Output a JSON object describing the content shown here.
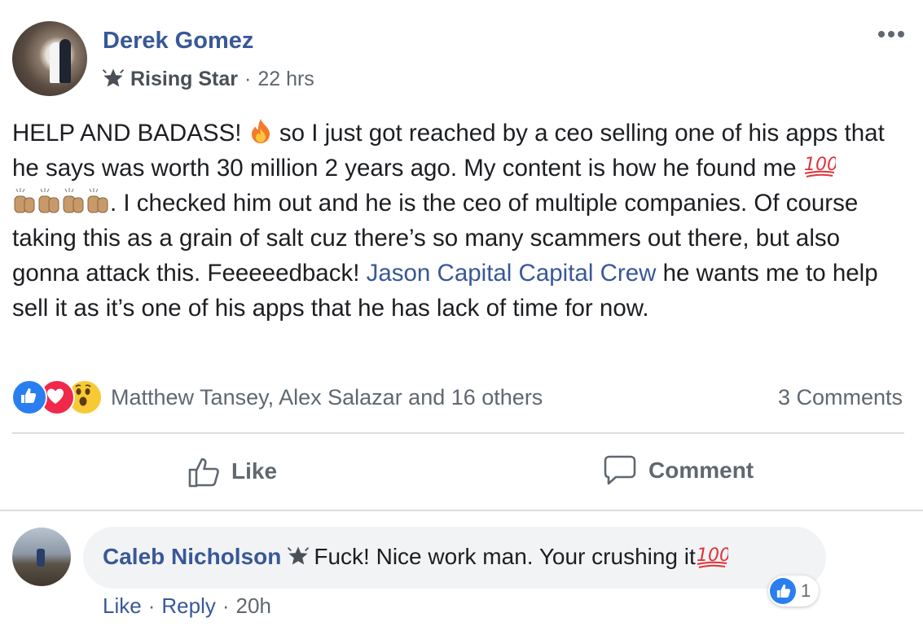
{
  "post": {
    "author": "Derek Gomez",
    "badge": "Rising Star",
    "time": "22 hrs",
    "text": {
      "part1": "HELP AND BADASS!",
      "part2": "so I just got reached by a ceo selling one of his apps that he says was worth 30 million 2 years ago. My content is how he found me",
      "part3": ". I checked him out and he is the ceo of multiple companies. Of course taking this as a grain of salt cuz there’s so many scammers out there, but also gonna attack this. Feeeeedback!",
      "mention": "Jason Capital Capital Crew",
      "part4": "he wants me to help sell it as it’s one of his apps that he has lack of time for now."
    },
    "reactions_text": "Matthew Tansey, Alex Salazar and 16 others",
    "comments_count": "3 Comments",
    "actions": {
      "like": "Like",
      "comment": "Comment"
    }
  },
  "comment": {
    "author": "Caleb Nicholson",
    "text": "Fuck! Nice work man. Your crushing it",
    "like_count": "1",
    "actions": {
      "like": "Like",
      "reply": "Reply",
      "time": "20h"
    }
  },
  "icons": [
    "rising-star-icon",
    "fire-emoji",
    "hundred-emoji",
    "clapping-hands-emoji",
    "like-reaction-icon",
    "love-reaction-icon",
    "wow-reaction-icon",
    "thumbs-up-icon",
    "comment-bubble-icon",
    "more-options-icon"
  ],
  "colors": {
    "link": "#385898",
    "secondary": "#606770",
    "like_blue": "#2a7ef0",
    "love_red": "#f0284a",
    "wow_yellow": "#f7c935"
  }
}
